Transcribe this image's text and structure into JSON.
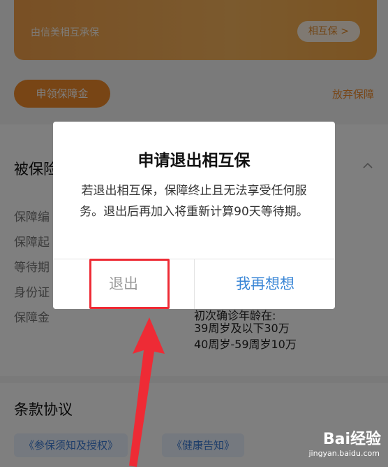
{
  "insurer": {
    "text": "由信美相互承保",
    "link_label": "相互保 >"
  },
  "actions": {
    "apply_label": "申领保障金",
    "give_up_label": "放弃保障"
  },
  "insured_section": {
    "title": "被保险",
    "rows": [
      "保障编",
      "保障起",
      "等待期",
      "身份证",
      "保障金"
    ],
    "coverage_lines": [
      "初次确诊年龄在:",
      "39周岁及以下30万",
      "40周岁-59周岁10万"
    ]
  },
  "terms": {
    "title": "条款协议",
    "links": [
      "《参保须知及授权》",
      "《健康告知》"
    ]
  },
  "dialog": {
    "title": "申请退出相互保",
    "message": "若退出相互保，保障终止且无法享受任何服务。退出后再加入将重新计算90天等待期。",
    "exit_label": "退出",
    "reconsider_label": "我再想想"
  },
  "watermark": {
    "main": "Bai经验",
    "sub": "jingyan.baidu.com"
  },
  "colors": {
    "accent_orange": "#f08a2a",
    "link_blue": "#3a86d6",
    "highlight_red": "#ee2b35"
  }
}
